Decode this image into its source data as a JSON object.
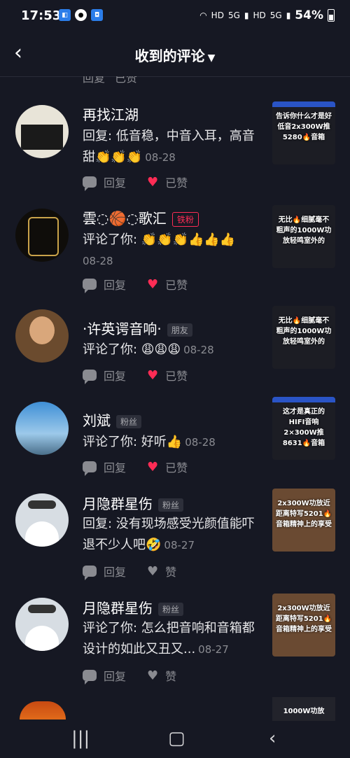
{
  "status_bar": {
    "time": "17:53",
    "network": "HD",
    "signal_a": "5G",
    "signal_b": "5G",
    "battery": "54%"
  },
  "header": {
    "title": "收到的评论"
  },
  "partial_top": {
    "reply": "回复",
    "liked": "已赞"
  },
  "items": [
    {
      "name": "再找江湖",
      "tag": "",
      "text": "回复: 低音稳，中音入耳，高音甜👏👏👏",
      "date": "08-28",
      "reply": "回复",
      "like": "已赞",
      "liked": true,
      "thumb": "告诉你什么才是好低音2x300W推5280🔥音箱"
    },
    {
      "name": "雲◌🏀◌歌汇",
      "tag": "铁粉",
      "text": "评论了你: 👏👏👏👍👍👍",
      "date": "08-28",
      "reply": "回复",
      "like": "已赞",
      "liked": true,
      "thumb": "无比🔥细腻毫不粗声的1000W功放轻鸣室外的"
    },
    {
      "name": "·许英谔音响·",
      "tag": "朋友",
      "text": "评论了你: 😩😩😩",
      "date": "08-28",
      "reply": "回复",
      "like": "已赞",
      "liked": true,
      "thumb": "无比🔥细腻毫不粗声的1000W功放轻鸣室外的"
    },
    {
      "name": "刘斌",
      "tag": "粉丝",
      "text": "评论了你: 好听👍",
      "date": "08-28",
      "reply": "回复",
      "like": "已赞",
      "liked": true,
      "thumb": "这才是真正的HIFI音响2×300W推8631🔥音箱"
    },
    {
      "name": "月隐群星伤",
      "tag": "粉丝",
      "text": "回复: 没有现场感受光颜值能吓退不少人吧🤣",
      "date": "08-27",
      "reply": "回复",
      "like": "赞",
      "liked": false,
      "thumb": "2x300W功放近距离特写5201🔥音箱精神上的享受"
    },
    {
      "name": "月隐群星伤",
      "tag": "粉丝",
      "text": "评论了你: 怎么把音响和音箱都设计的如此又丑又...",
      "date": "08-27",
      "reply": "回复",
      "like": "赞",
      "liked": false,
      "thumb": "2x300W功放近距离特写5201🔥音箱精神上的享受"
    }
  ],
  "partial_bottom": {
    "thumb": "1000W功放"
  },
  "colors": {
    "background": "#161823",
    "like_red": "#fe2c55",
    "muted": "#8a8b91"
  }
}
